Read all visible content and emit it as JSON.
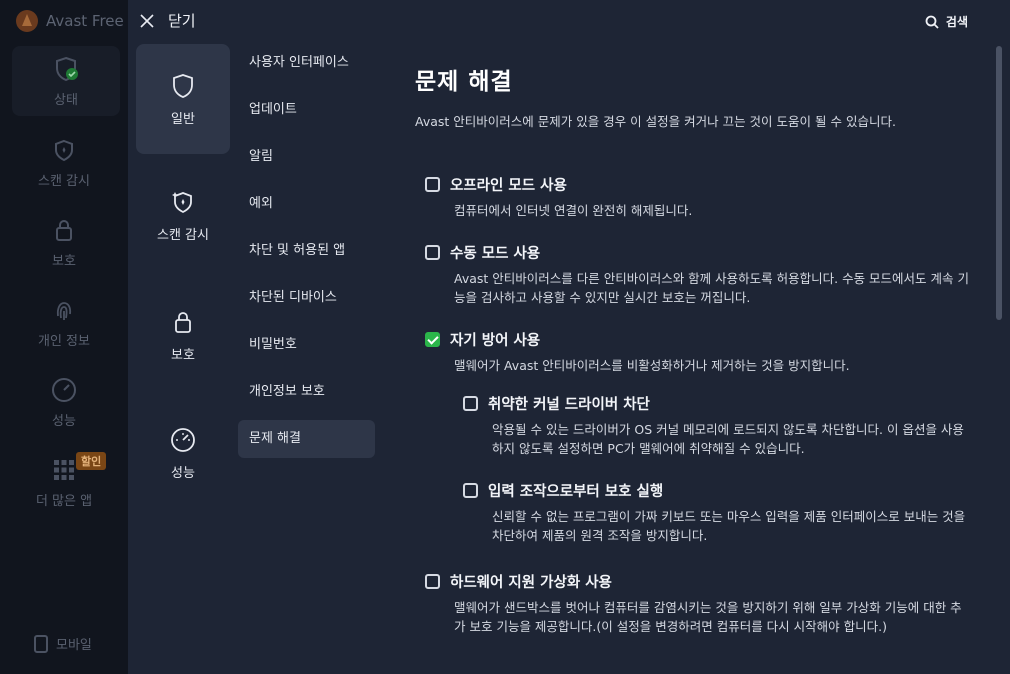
{
  "background_app": {
    "title": "Avast Free",
    "nav": [
      {
        "label": "상태",
        "icon": "shield-check-icon"
      },
      {
        "label": "스캔 감시",
        "icon": "scan-shield-icon"
      },
      {
        "label": "보호",
        "icon": "lock-icon"
      },
      {
        "label": "개인 정보",
        "icon": "fingerprint-icon"
      },
      {
        "label": "성능",
        "icon": "gauge-icon"
      },
      {
        "label": "더 많은 앱",
        "icon": "grid-icon"
      }
    ],
    "badge": "할인",
    "mobile": "모바일"
  },
  "topbar": {
    "close_label": "닫기",
    "search_label": "검색"
  },
  "categories": [
    {
      "label": "일반",
      "icon": "shield-icon",
      "active": true
    },
    {
      "label": "스캔 감시",
      "icon": "scan-shield-icon",
      "active": false
    },
    {
      "label": "보호",
      "icon": "lock-icon",
      "active": false
    },
    {
      "label": "성능",
      "icon": "gauge-icon",
      "active": false
    }
  ],
  "subcategories": [
    "사용자 인터페이스",
    "업데이트",
    "알림",
    "예외",
    "차단 및 허용된 앱",
    "차단된 디바이스",
    "비밀번호",
    "개인정보 보호",
    "문제 해결"
  ],
  "active_subcategory": "문제 해결",
  "page": {
    "title": "문제 해결",
    "description": "Avast 안티바이러스에 문제가 있을 경우 이 설정을 켜거나 끄는 것이 도움이 될 수 있습니다.",
    "options": [
      {
        "title": "오프라인 모드 사용",
        "desc": "컴퓨터에서 인터넷 연결이 완전히 해제됩니다.",
        "checked": false
      },
      {
        "title": "수동 모드 사용",
        "desc": "Avast 안티바이러스를 다른 안티바이러스와 함께 사용하도록 허용합니다. 수동 모드에서도 계속 기능을 검사하고 사용할 수 있지만 실시간 보호는 꺼집니다.",
        "checked": false
      },
      {
        "title": "자기 방어 사용",
        "desc": "맬웨어가 Avast 안티바이러스를 비활성화하거나 제거하는 것을 방지합니다.",
        "checked": true
      },
      {
        "title": "취약한 커널 드라이버 차단",
        "desc": "악용될 수 있는 드라이버가 OS 커널 메모리에 로드되지 않도록 차단합니다. 이 옵션을 사용하지 않도록 설정하면 PC가 맬웨어에 취약해질 수 있습니다.",
        "checked": false
      },
      {
        "title": "입력 조작으로부터 보호 실행",
        "desc": "신뢰할 수 없는 프로그램이 가짜 키보드 또는 마우스 입력을 제품 인터페이스로 보내는 것을 차단하여 제품의 원격 조작을 방지합니다.",
        "checked": false
      },
      {
        "title": "하드웨어 지원 가상화 사용",
        "desc": "맬웨어가 샌드박스를 벗어나 컴퓨터를 감염시키는 것을 방지하기 위해 일부 가상화 기능에 대한 추가 보호 기능을 제공합니다.(이 설정을 변경하려면 컴퓨터를 다시 시작해야 합니다.)",
        "checked": false
      }
    ]
  },
  "colors": {
    "accent_green": "#2bb54a",
    "panel_bg": "#1e2535",
    "active_item_bg": "#2e3648",
    "badge_bg": "#7a4615"
  }
}
